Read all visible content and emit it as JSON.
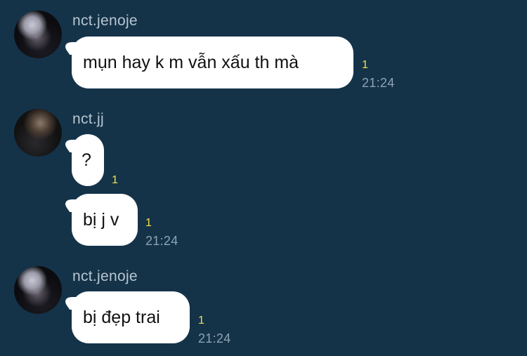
{
  "messages": [
    {
      "sender": "nct.jenoje",
      "avatar_icon": "user-avatar-icon",
      "text": "mụn hay k m vẫn xấu th mà",
      "read_count": "1",
      "time": "21:24"
    },
    {
      "sender": "nct.jj",
      "avatar_icon": "user-avatar-icon",
      "texts": [
        {
          "text": "?",
          "read_count": "1",
          "time": ""
        },
        {
          "text": "bị j v",
          "read_count": "1",
          "time": "21:24"
        }
      ]
    },
    {
      "sender": "nct.jenoje",
      "avatar_icon": "user-avatar-icon",
      "text": "bị đẹp trai",
      "read_count": "1",
      "time": "21:24"
    }
  ],
  "colors": {
    "background": "#143349",
    "bubble": "#ffffff",
    "read_indicator": "#f3e24a",
    "username": "#b8c5cf",
    "timestamp": "#8fa3b1"
  }
}
